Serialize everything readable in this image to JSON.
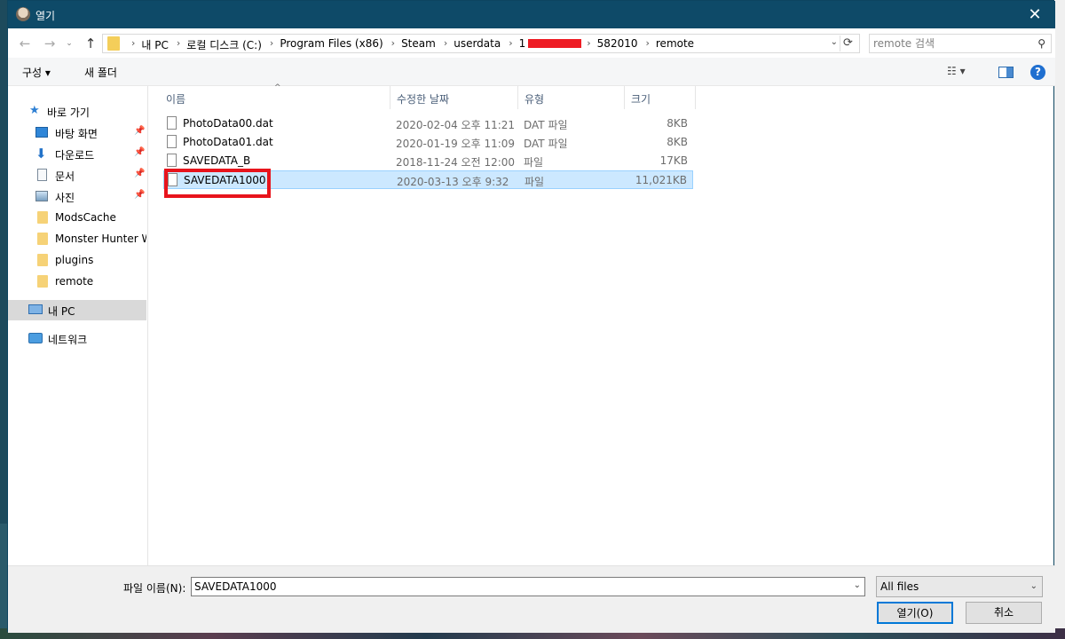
{
  "window": {
    "title": "열기",
    "close_glyph": "✕"
  },
  "nav_buttons": {
    "back": "←",
    "forward": "→",
    "recent": "⌄",
    "up": "↑"
  },
  "address": {
    "crumbs": [
      "내 PC",
      "로컬 디스크 (C:)",
      "Program Files (x86)",
      "Steam",
      "userdata",
      "1",
      "582010",
      "remote"
    ],
    "separator": "›",
    "dropdown_glyph": "⌄",
    "refresh_glyph": "⟳"
  },
  "search": {
    "placeholder": "remote 검색",
    "icon_glyph": "⚲"
  },
  "command_bar": {
    "organize": "구성 ▾",
    "new_folder": "새 폴더",
    "view_glyph": "☷ ▾",
    "help_glyph": "?"
  },
  "nav_pane": {
    "quick_access": "바로 가기",
    "items": [
      {
        "label": "바탕 화면",
        "pinned": true
      },
      {
        "label": "다운로드",
        "pinned": true
      },
      {
        "label": "문서",
        "pinned": true
      },
      {
        "label": "사진",
        "pinned": true
      },
      {
        "label": "ModsCache",
        "pinned": false
      },
      {
        "label": "Monster Hunter World",
        "pinned": false
      },
      {
        "label": "plugins",
        "pinned": false
      },
      {
        "label": "remote",
        "pinned": false
      }
    ],
    "this_pc": "내 PC",
    "network": "네트워크",
    "pin_glyph": "📌"
  },
  "file_list": {
    "columns": {
      "name": "이름",
      "modified": "수정한 날짜",
      "type": "유형",
      "size": "크기"
    },
    "sort_glyph": "^",
    "rows": [
      {
        "name": "PhotoData00.dat",
        "modified": "2020-02-04 오후 11:21",
        "type": "DAT 파일",
        "size": "8KB"
      },
      {
        "name": "PhotoData01.dat",
        "modified": "2020-01-19 오후 11:09",
        "type": "DAT 파일",
        "size": "8KB"
      },
      {
        "name": "SAVEDATA_B",
        "modified": "2018-11-24 오전 12:00",
        "type": "파일",
        "size": "17KB"
      },
      {
        "name": "SAVEDATA1000",
        "modified": "2020-03-13 오후 9:32",
        "type": "파일",
        "size": "11,021KB"
      }
    ],
    "selected_index": 3
  },
  "bottom": {
    "filename_label": "파일 이름(N):",
    "filename_value": "SAVEDATA1000",
    "filetype_value": "All files",
    "dropdown_glyph": "⌄",
    "open_button": "열기(O)",
    "cancel_button": "취소"
  },
  "colors": {
    "titlebar": "#0e4a68",
    "selection": "#cce8ff",
    "highlight_box": "#e8141c",
    "redaction": "#ee1c24"
  }
}
